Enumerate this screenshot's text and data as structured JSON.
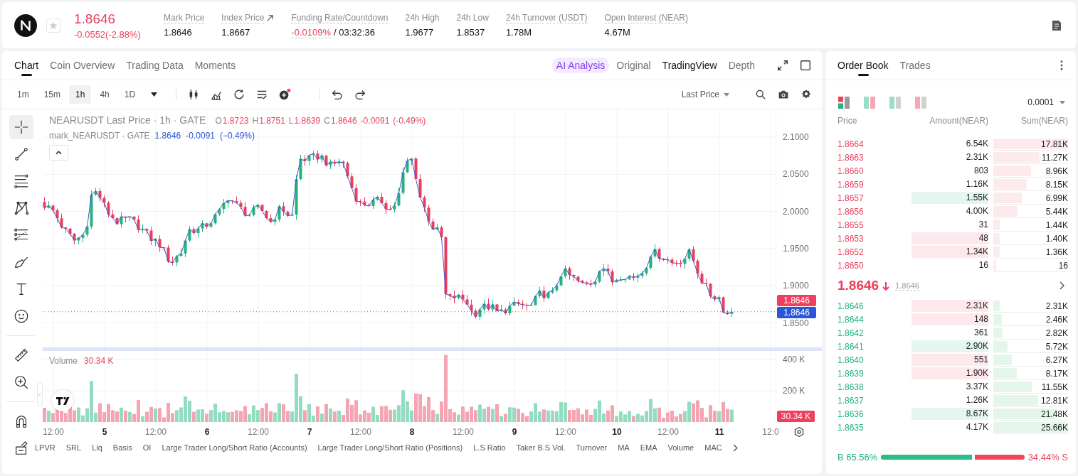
{
  "header": {
    "price": "1.8646",
    "change": "-0.0552(-2.88%)",
    "negative": true,
    "favorite": false,
    "stats": [
      {
        "label": "Mark Price",
        "value": "1.8646",
        "kind": "plain",
        "tooltip": true
      },
      {
        "label": "Index Price",
        "value": "1.8667",
        "kind": "link",
        "tooltip": true
      },
      {
        "label": "Funding Rate/Countdown",
        "value": "-0.0109%",
        "countdown": "/ 03:32:36",
        "kind": "funding",
        "tooltip": true
      },
      {
        "label": "24h High",
        "value": "1.9677",
        "kind": "plain",
        "tooltip": false
      },
      {
        "label": "24h Low",
        "value": "1.8537",
        "kind": "plain",
        "tooltip": false
      },
      {
        "label": "24h Turnover (USDT)",
        "value": "1.78M",
        "kind": "plain",
        "tooltip": true
      },
      {
        "label": "Open Interest (NEAR)",
        "value": "4.67M",
        "kind": "plain",
        "tooltip": true
      }
    ]
  },
  "chart_panel": {
    "tabs": [
      {
        "label": "Chart",
        "selected": true
      },
      {
        "label": "Coin Overview",
        "selected": false
      },
      {
        "label": "Trading Data",
        "selected": false
      },
      {
        "label": "Moments",
        "selected": false
      }
    ],
    "ai_button": "AI Analysis",
    "views": [
      {
        "label": "Original",
        "selected": false
      },
      {
        "label": "TradingView",
        "selected": true
      },
      {
        "label": "Depth",
        "selected": false
      }
    ],
    "intervals": [
      {
        "label": "1m",
        "selected": false
      },
      {
        "label": "15m",
        "selected": false
      },
      {
        "label": "1h",
        "selected": true
      },
      {
        "label": "4h",
        "selected": false
      },
      {
        "label": "1D",
        "selected": false
      }
    ],
    "price_source": "Last Price",
    "tools": [
      {
        "kind": "crosshair",
        "selected": true
      },
      {
        "kind": "trend-line",
        "selected": false
      },
      {
        "kind": "parallel-lines",
        "selected": false
      },
      {
        "kind": "pattern",
        "selected": false
      },
      {
        "kind": "fib",
        "selected": false
      },
      {
        "kind": "brush",
        "selected": false
      },
      {
        "kind": "text",
        "selected": false
      },
      {
        "kind": "emoji",
        "selected": false
      },
      {
        "kind": "ruler",
        "selected": false
      },
      {
        "kind": "zoom",
        "selected": false
      },
      {
        "kind": "magnet",
        "selected": false
      },
      {
        "kind": "edit",
        "selected": false
      }
    ],
    "legend": {
      "title": "NEARUSDT Last Price · 1h · GATE",
      "ohlc": [
        {
          "key": "O",
          "value": "1.8723"
        },
        {
          "key": "H",
          "value": "1.8751"
        },
        {
          "key": "L",
          "value": "1.8639"
        },
        {
          "key": "C",
          "value": "1.8646"
        }
      ],
      "change": "-0.0091",
      "change_pct": "(-0.49%)",
      "negative": true
    },
    "mark_legend": {
      "title": "mark_NEARUSDT · GATE",
      "values": [
        "1.8646",
        "-0.0091",
        "(−0.49%)"
      ]
    },
    "price_axis": [
      "2.1000",
      "2.0500",
      "2.0000",
      "1.9500",
      "1.9000",
      "1.8500"
    ],
    "price_tags": [
      {
        "label": "1.8646",
        "kind": "last"
      },
      {
        "label": "1.8646",
        "kind": "mark"
      }
    ],
    "volume_legend": {
      "title": "Volume",
      "value": "30.34 K"
    },
    "volume_axis": [
      "400 K",
      "200 K"
    ],
    "volume_tag": "30.34 K",
    "time_axis": [
      {
        "label": "12:00",
        "kind": "time"
      },
      {
        "label": "5",
        "kind": "day"
      },
      {
        "label": "12:00",
        "kind": "time"
      },
      {
        "label": "6",
        "kind": "day"
      },
      {
        "label": "12:00",
        "kind": "time"
      },
      {
        "label": "7",
        "kind": "day"
      },
      {
        "label": "12:00",
        "kind": "time"
      },
      {
        "label": "8",
        "kind": "day"
      },
      {
        "label": "12:00",
        "kind": "time"
      },
      {
        "label": "9",
        "kind": "day"
      },
      {
        "label": "12:00",
        "kind": "time"
      },
      {
        "label": "10",
        "kind": "day"
      },
      {
        "label": "12:00",
        "kind": "time"
      },
      {
        "label": "11",
        "kind": "day"
      },
      {
        "label": "12:0",
        "kind": "time"
      }
    ],
    "indicators": [
      "LPVR",
      "SRL",
      "Liq",
      "Basis",
      "OI",
      "Large Trader Long/Short Ratio (Accounts)",
      "Large Trader Long/Short Ratio (Positions)",
      "L.S Ratio",
      "Taker B.S Vol.",
      "Turnover",
      "MA",
      "EMA",
      "Volume",
      "MAC"
    ]
  },
  "order_book": {
    "tabs": [
      {
        "label": "Order Book",
        "selected": true
      },
      {
        "label": "Trades",
        "selected": false
      }
    ],
    "view_modes": [
      {
        "kind": "both",
        "selected": true
      },
      {
        "kind": "split",
        "selected": false
      },
      {
        "kind": "bids",
        "selected": false
      },
      {
        "kind": "asks",
        "selected": false
      }
    ],
    "precision": "0.0001",
    "columns": [
      "Price",
      "Amount(NEAR)",
      "Sum(NEAR)"
    ],
    "asks": [
      {
        "price": "1.8664",
        "amount": "6.54K",
        "sum": "17.81K",
        "level": 1.0
      },
      {
        "price": "1.8663",
        "amount": "2.31K",
        "sum": "11.27K",
        "level": 0.62
      },
      {
        "price": "1.8660",
        "amount": "803",
        "sum": "8.96K",
        "level": 0.5
      },
      {
        "price": "1.8659",
        "amount": "1.16K",
        "sum": "8.15K",
        "level": 0.45
      },
      {
        "price": "1.8657",
        "amount": "1.55K",
        "sum": "6.99K",
        "level": 0.38,
        "color": "#e5f6ef"
      },
      {
        "price": "1.8656",
        "amount": "4.00K",
        "sum": "5.44K",
        "level": 0.32
      },
      {
        "price": "1.8655",
        "amount": "31",
        "sum": "1.44K",
        "level": 0.09
      },
      {
        "price": "1.8653",
        "amount": "48",
        "sum": "1.40K",
        "level": 0.09,
        "color": "#fde9ec"
      },
      {
        "price": "1.8652",
        "amount": "1.34K",
        "sum": "1.36K",
        "level": 0.09,
        "color": "#fde9ec"
      },
      {
        "price": "1.8650",
        "amount": "16",
        "sum": "16",
        "level": 0.04
      }
    ],
    "last_price": {
      "value": "1.8646",
      "mark": "1.8646",
      "falling": true
    },
    "bids": [
      {
        "price": "1.8646",
        "amount": "2.31K",
        "sum": "2.31K",
        "level": 0.09,
        "color": "#fde9ec"
      },
      {
        "price": "1.8644",
        "amount": "148",
        "sum": "2.46K",
        "level": 0.11,
        "color": "#fde9ec"
      },
      {
        "price": "1.8642",
        "amount": "361",
        "sum": "2.82K",
        "level": 0.12
      },
      {
        "price": "1.8641",
        "amount": "2.90K",
        "sum": "5.72K",
        "level": 0.19,
        "color": "#e5f6ef"
      },
      {
        "price": "1.8640",
        "amount": "551",
        "sum": "6.27K",
        "level": 0.25,
        "color": "#fde9ec"
      },
      {
        "price": "1.8639",
        "amount": "1.90K",
        "sum": "8.17K",
        "level": 0.31,
        "color": "#fde9ec"
      },
      {
        "price": "1.8638",
        "amount": "3.37K",
        "sum": "11.55K",
        "level": 0.51
      },
      {
        "price": "1.8637",
        "amount": "1.26K",
        "sum": "12.81K",
        "level": 0.6
      },
      {
        "price": "1.8636",
        "amount": "8.67K",
        "sum": "21.48K",
        "level": 0.85,
        "color": "#e5f6ef"
      },
      {
        "price": "1.8635",
        "amount": "4.17K",
        "sum": "25.66K",
        "level": 1.0
      }
    ],
    "ratio": {
      "buy": "B 65.56%",
      "sell": "34.44% S",
      "level": 0.6556
    }
  }
}
